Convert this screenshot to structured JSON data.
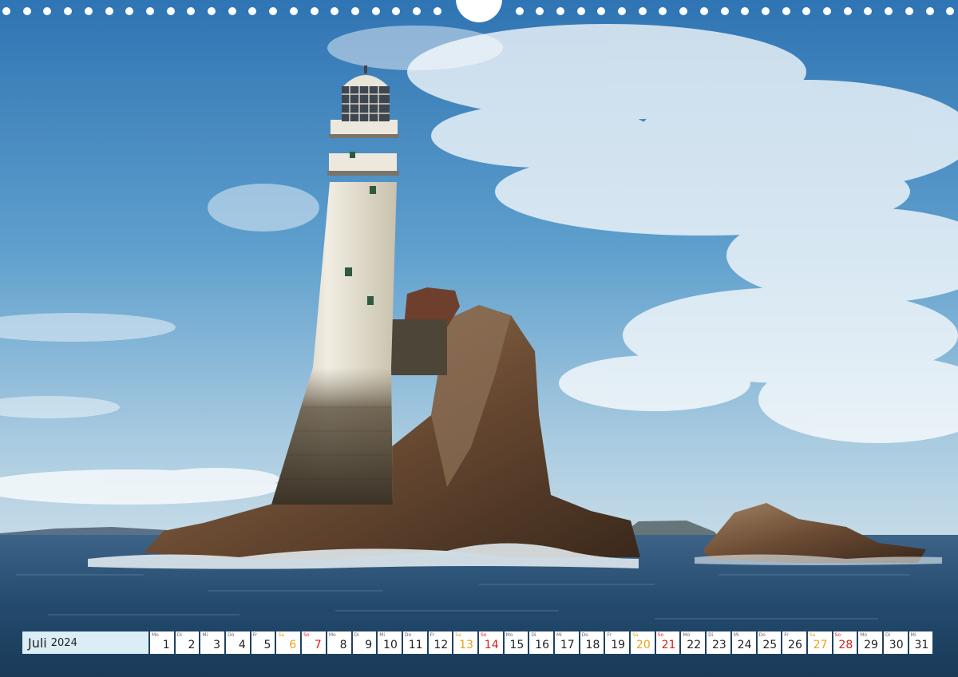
{
  "calendar": {
    "month": "Juli",
    "year": "2024",
    "days": [
      {
        "wd": "Mo",
        "n": "1",
        "kind": "weekday"
      },
      {
        "wd": "Di",
        "n": "2",
        "kind": "weekday"
      },
      {
        "wd": "Mi",
        "n": "3",
        "kind": "weekday"
      },
      {
        "wd": "Do",
        "n": "4",
        "kind": "weekday"
      },
      {
        "wd": "Fr",
        "n": "5",
        "kind": "weekday"
      },
      {
        "wd": "Sa",
        "n": "6",
        "kind": "saturday"
      },
      {
        "wd": "So",
        "n": "7",
        "kind": "sunday"
      },
      {
        "wd": "Mo",
        "n": "8",
        "kind": "weekday"
      },
      {
        "wd": "Di",
        "n": "9",
        "kind": "weekday"
      },
      {
        "wd": "Mi",
        "n": "10",
        "kind": "weekday"
      },
      {
        "wd": "Do",
        "n": "11",
        "kind": "weekday"
      },
      {
        "wd": "Fr",
        "n": "12",
        "kind": "weekday"
      },
      {
        "wd": "Sa",
        "n": "13",
        "kind": "saturday"
      },
      {
        "wd": "So",
        "n": "14",
        "kind": "sunday"
      },
      {
        "wd": "Mo",
        "n": "15",
        "kind": "weekday"
      },
      {
        "wd": "Di",
        "n": "16",
        "kind": "weekday"
      },
      {
        "wd": "Mi",
        "n": "17",
        "kind": "weekday"
      },
      {
        "wd": "Do",
        "n": "18",
        "kind": "weekday"
      },
      {
        "wd": "Fr",
        "n": "19",
        "kind": "weekday"
      },
      {
        "wd": "Sa",
        "n": "20",
        "kind": "saturday"
      },
      {
        "wd": "So",
        "n": "21",
        "kind": "sunday"
      },
      {
        "wd": "Mo",
        "n": "22",
        "kind": "weekday"
      },
      {
        "wd": "Di",
        "n": "23",
        "kind": "weekday"
      },
      {
        "wd": "Mi",
        "n": "24",
        "kind": "weekday"
      },
      {
        "wd": "Do",
        "n": "25",
        "kind": "weekday"
      },
      {
        "wd": "Fr",
        "n": "26",
        "kind": "weekday"
      },
      {
        "wd": "Sa",
        "n": "27",
        "kind": "saturday"
      },
      {
        "wd": "So",
        "n": "28",
        "kind": "sunday"
      },
      {
        "wd": "Mo",
        "n": "29",
        "kind": "weekday"
      },
      {
        "wd": "Di",
        "n": "30",
        "kind": "weekday"
      },
      {
        "wd": "Mi",
        "n": "31",
        "kind": "weekday"
      }
    ]
  },
  "colors": {
    "saturday": "#e6a317",
    "sunday": "#d81f1f",
    "title_background": "#dbeef6",
    "day_background": "#ffffff"
  }
}
